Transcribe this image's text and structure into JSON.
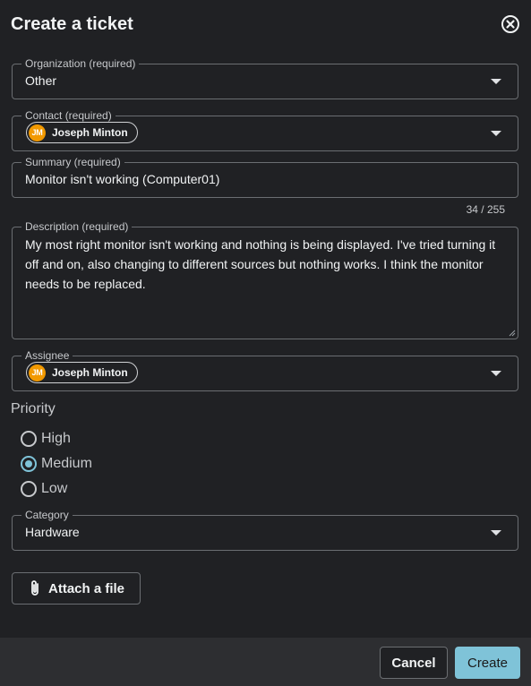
{
  "dialog": {
    "title": "Create a ticket",
    "close_icon": "close-circle-icon"
  },
  "organization": {
    "label": "Organization (required)",
    "value": "Other"
  },
  "contact": {
    "label": "Contact (required)",
    "chip": {
      "initials": "JM",
      "name": "Joseph Minton"
    }
  },
  "summary": {
    "label": "Summary (required)",
    "value": "Monitor isn't working (Computer01)",
    "counter": "34 / 255"
  },
  "description": {
    "label": "Description (required)",
    "value": "My most right monitor isn't working and nothing is being displayed. I've tried turning it off and on, also changing to different sources but nothing works. I think the monitor needs to be replaced."
  },
  "assignee": {
    "label": "Assignee",
    "chip": {
      "initials": "JM",
      "name": "Joseph Minton"
    }
  },
  "priority": {
    "label": "Priority",
    "options": [
      {
        "label": "High",
        "selected": false
      },
      {
        "label": "Medium",
        "selected": true
      },
      {
        "label": "Low",
        "selected": false
      }
    ]
  },
  "category": {
    "label": "Category",
    "value": "Hardware"
  },
  "attach": {
    "label": "Attach a file",
    "icon": "paperclip-icon"
  },
  "footer": {
    "cancel_label": "Cancel",
    "create_label": "Create"
  },
  "colors": {
    "background": "#202124",
    "accent": "#7fc3d8",
    "avatar": "#f29900",
    "footer": "#2d2e31"
  }
}
